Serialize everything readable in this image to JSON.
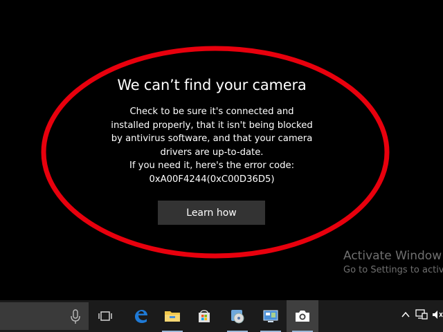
{
  "dialog": {
    "title": "We can’t find your camera",
    "body_lines": [
      "Check to be sure it's connected and",
      "installed properly, that it isn't being blocked",
      "by antivirus software, and that your camera",
      "drivers are up-to-date.",
      "If you need it, here's the error code:",
      "0xA00F4244(0xC00D36D5)"
    ],
    "learn_button": "Learn how"
  },
  "watermark": {
    "title": "Activate Window",
    "subtitle": "Go to Settings to activ"
  },
  "taskbar": {
    "icons": [
      "microphone-icon",
      "task-view-icon",
      "edge-browser-icon",
      "file-explorer-icon",
      "store-icon",
      "media-app-icon",
      "control-panel-icon",
      "camera-app-icon"
    ],
    "tray_icons": [
      "chevron-up-icon",
      "network-icon",
      "volume-icon"
    ]
  },
  "colors": {
    "background": "#000000",
    "highlight_ring": "#e8000d",
    "button": "#333333",
    "taskbar": "#1b1b1b",
    "watermark": "#707070"
  }
}
